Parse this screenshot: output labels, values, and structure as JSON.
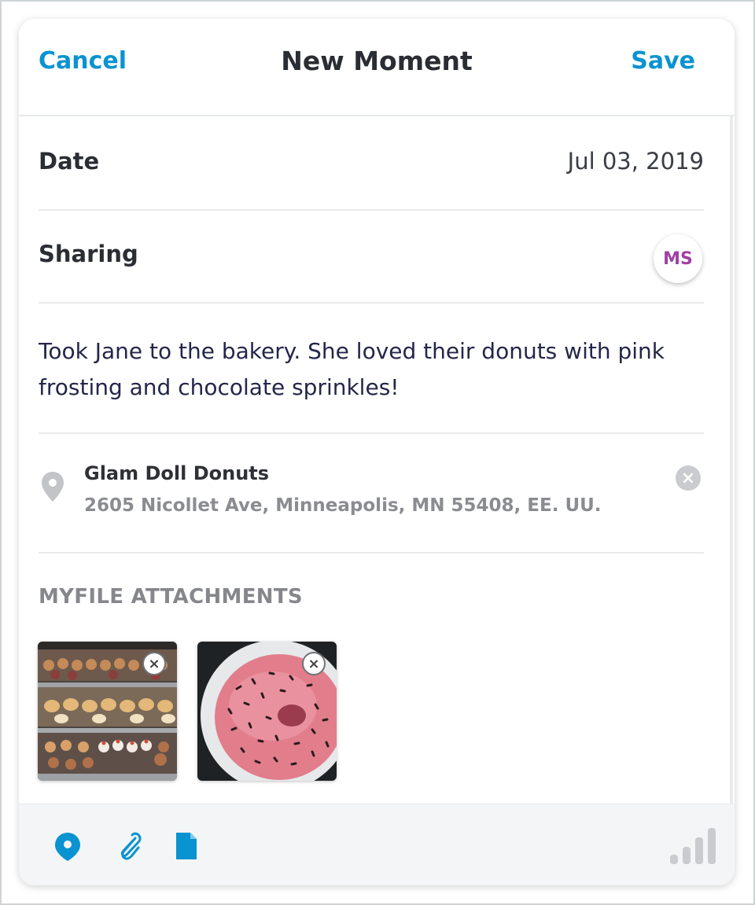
{
  "header": {
    "cancel_label": "Cancel",
    "title": "New Moment",
    "save_label": "Save"
  },
  "date": {
    "label": "Date",
    "value": "Jul 03, 2019"
  },
  "sharing": {
    "label": "Sharing",
    "avatar_initials": "MS"
  },
  "note": {
    "text": "Took Jane to the bakery. She loved their donuts with pink frosting and chocolate sprinkles!"
  },
  "location": {
    "icon": "location-pin-icon",
    "name": "Glam Doll Donuts",
    "address": "2605 Nicollet Ave, Minneapolis, MN 55408, EE. UU.",
    "clear_glyph": "×"
  },
  "attachments": {
    "heading": "MYFILE ATTACHMENTS",
    "items": [
      {
        "image": "bakery-display-case",
        "remove_glyph": "×"
      },
      {
        "image": "pink-sprinkle-donut",
        "remove_glyph": "×"
      }
    ]
  },
  "toolbar": {
    "icons": [
      "location-pin-icon",
      "paperclip-icon",
      "document-icon",
      "signal-strength-icon"
    ]
  },
  "colors": {
    "accent": "#0a93d1",
    "avatar_text": "#a040a6",
    "muted": "#85878b"
  }
}
